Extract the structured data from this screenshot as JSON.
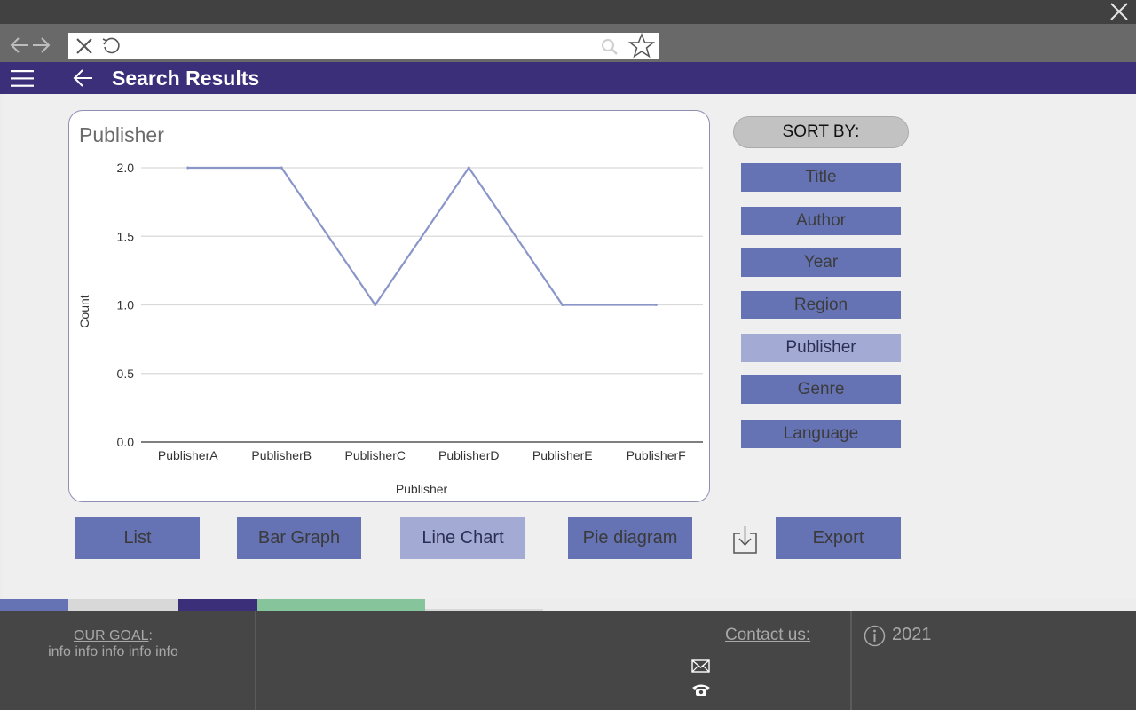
{
  "app": {
    "title": "Search Results"
  },
  "browser": {
    "url_value": ""
  },
  "chart": {
    "card_title": "Publisher"
  },
  "chart_data": {
    "type": "line",
    "categories": [
      "PublisherA",
      "PublisherB",
      "PublisherC",
      "PublisherD",
      "PublisherE",
      "PublisherF"
    ],
    "values": [
      2,
      2,
      1,
      2,
      1,
      1
    ],
    "title": "Publisher",
    "xlabel": "Publisher",
    "ylabel": "Count",
    "ylim": [
      0,
      2
    ],
    "yticks": [
      "0.0",
      "0.5",
      "1.0",
      "1.5",
      "2.0"
    ],
    "grid": true,
    "line_color": "#8a96c8"
  },
  "sort": {
    "heading": "SORT BY:",
    "options": [
      {
        "label": "Title",
        "active": false
      },
      {
        "label": "Author",
        "active": false
      },
      {
        "label": "Year",
        "active": false
      },
      {
        "label": "Region",
        "active": false
      },
      {
        "label": "Publisher",
        "active": true
      },
      {
        "label": "Genre",
        "active": false
      },
      {
        "label": "Language",
        "active": false
      }
    ]
  },
  "views": {
    "list": "List",
    "bar": "Bar Graph",
    "line": "Line Chart",
    "pie": "Pie diagram",
    "export": "Export"
  },
  "footer": {
    "goal_link": "OUR GOAL",
    "goal_colon": ":",
    "goal_text": "info info info info info",
    "contact": "Contact us:",
    "year": "2021"
  },
  "colors": {
    "appbar": "#3b2f7a",
    "button": "#6573b4",
    "button_active": "#a3abd5",
    "footer": "#464646"
  },
  "icons": {
    "close": "close-icon",
    "back": "back-arrow-icon",
    "forward": "forward-arrow-icon",
    "menu": "hamburger-icon",
    "search": "search-icon",
    "bookmark": "star-icon",
    "reload": "reload-icon",
    "download": "download-icon",
    "mail": "mail-icon",
    "phone": "phone-icon",
    "info": "info-icon"
  }
}
